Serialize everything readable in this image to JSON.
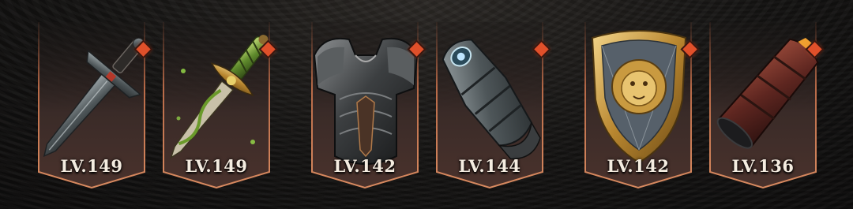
{
  "equipment": {
    "items": [
      {
        "name": "sword-icon",
        "level_label": "LV.149",
        "badge_color": "#e0502a"
      },
      {
        "name": "nature-dagger-icon",
        "level_label": "LV.149",
        "badge_color": "#e0502a"
      },
      {
        "name": "chest-armor-icon",
        "level_label": "LV.142",
        "badge_color": "#e0502a"
      },
      {
        "name": "gauntlet-icon",
        "level_label": "LV.144",
        "badge_color": "#e0502a"
      },
      {
        "name": "lion-shield-icon",
        "level_label": "LV.142",
        "badge_color": "#e0502a"
      },
      {
        "name": "bracer-icon",
        "level_label": "LV.136",
        "badge_color": "#e0502a"
      }
    ]
  }
}
